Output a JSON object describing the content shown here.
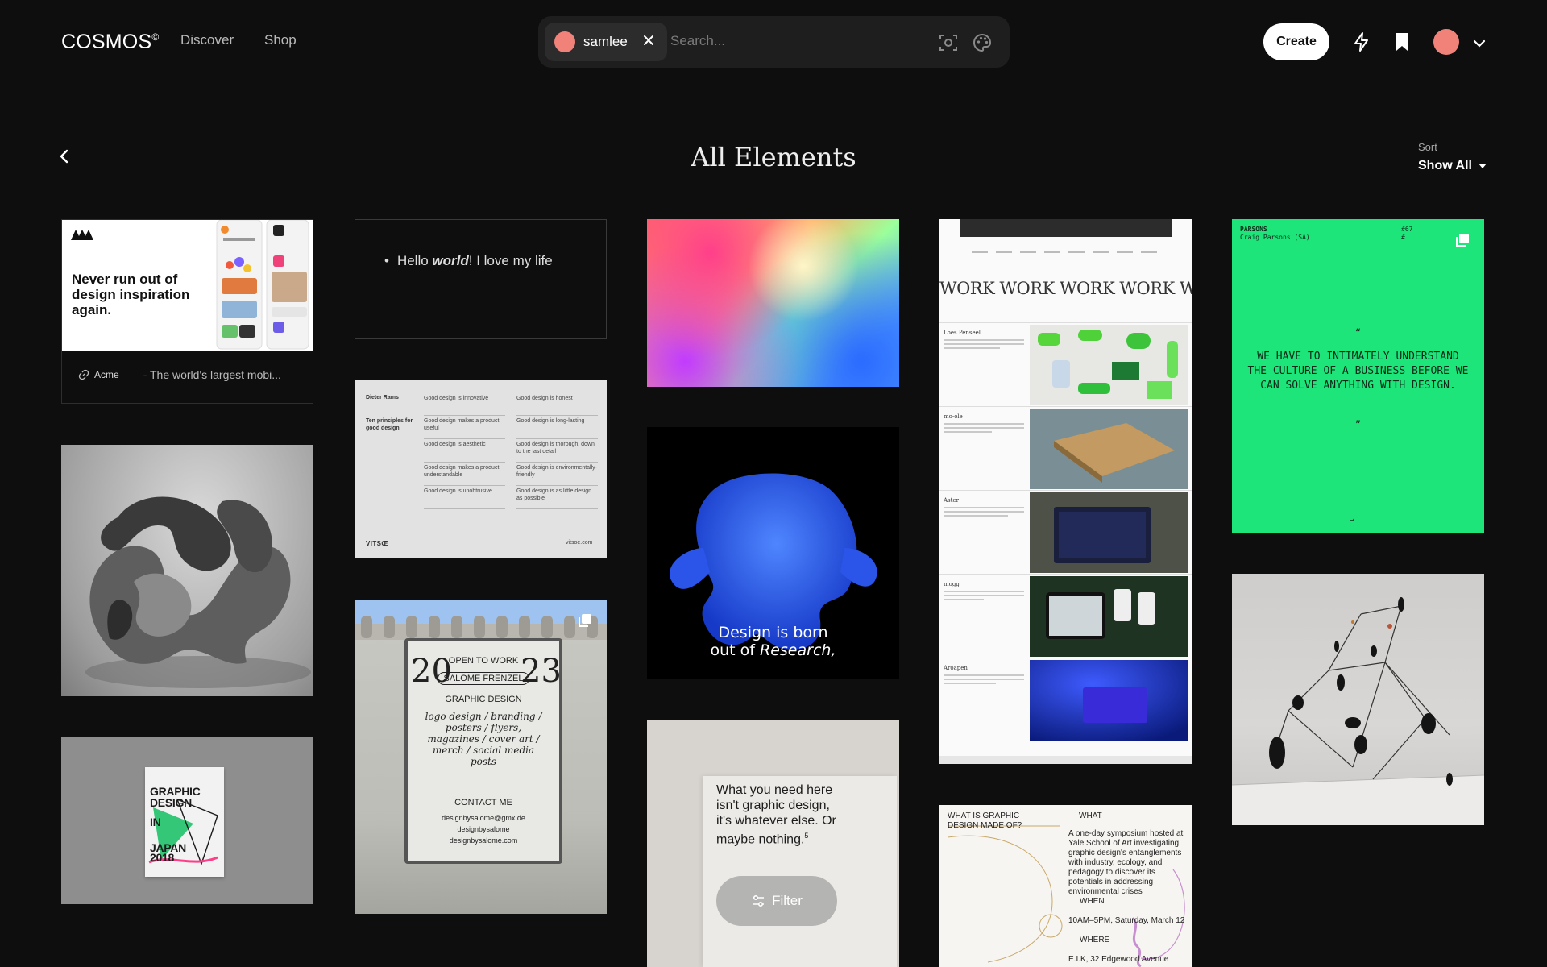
{
  "header": {
    "logo": "COSMOS",
    "logo_mark": "©",
    "nav": {
      "discover": "Discover",
      "shop": "Shop"
    },
    "search": {
      "chip_label": "samlee",
      "placeholder": "Search..."
    },
    "create_label": "Create",
    "icons": [
      "close-icon",
      "lens-icon",
      "palette-icon",
      "bolt-icon",
      "bookmark-icon",
      "chevron-down-icon"
    ]
  },
  "page": {
    "title": "All Elements",
    "sort_label": "Sort",
    "sort_value": "Show All"
  },
  "colors": {
    "background": "#0e0e0e",
    "accent_avatar": "#f0827a",
    "green_card": "#1de57a"
  },
  "cards": {
    "acme": {
      "headline": "Never run out of design inspiration again.",
      "link_name": "Acme",
      "link_desc": "- The world's largest mobi..."
    },
    "note": {
      "text_before": "Hello ",
      "emphasis": "world",
      "text_after": "! I love my life"
    },
    "work": {
      "repeat": "WORK WORK WORK WORK WORK W",
      "rows": [
        "Loes Penseel",
        "mo-ole",
        "Aster",
        "mogg",
        "Aroapen"
      ]
    },
    "green_quote": {
      "company": "PARSONS",
      "person": "Craig Parsons (SA)",
      "number": "#67",
      "hash": "#",
      "open_quote": "“",
      "quote": "WE HAVE TO INTIMATELY UNDERSTAND THE CULTURE OF A BUSINESS BEFORE WE CAN SOLVE ANYTHING WITH DESIGN.",
      "close_quote": "”",
      "arrow": "→"
    },
    "rams": {
      "name": "Dieter Rams",
      "subtitle": "Ten principles for good design",
      "principles": [
        "Good design is innovative",
        "Good design is honest",
        "Good design makes a product useful",
        "Good design is long-lasting",
        "Good design is aesthetic",
        "Good design is thorough, down to the last detail",
        "Good design makes a product understandable",
        "Good design is environmentally-friendly",
        "Good design is unobtrusive",
        "Good design is as little design as possible"
      ],
      "brand": "VITSŒ",
      "url": "vitsoe.com"
    },
    "video": {
      "caption_line1": "Design is born",
      "caption_line2_prefix": "out of ",
      "caption_line2_emph": "Research,"
    },
    "japan": {
      "line1": "GRAPHIC",
      "line2": "DESIGN",
      "line3": "IN",
      "line4": "JAPAN",
      "line5": "2018"
    },
    "open_to_work": {
      "num_left": "20",
      "num_right": "23",
      "line1": "OPEN TO WORK",
      "line2": "SALOME FRENZEL",
      "line3": "GRAPHIC DESIGN",
      "services": "logo design / branding / posters / flyers, magazines / cover art / merch / social media posts",
      "contact": "CONTACT ME",
      "email": "designbysalome@gmx.de",
      "handle": "designbysalome",
      "site": "designbysalome.com"
    },
    "need": {
      "text": "What you need here isn't graphic design, it's whatever else. Or maybe nothing.",
      "footnote": "5",
      "filter_label": "Filter"
    },
    "symposium": {
      "question": "WHAT IS GRAPHIC DESIGN MADE OF?",
      "what_label": "WHAT",
      "description": "A one-day symposium hosted at Yale School of Art investigating graphic design's entanglements with industry, ecology, and pedagogy to discover its potentials in addressing environmental crises",
      "when_label": "WHEN",
      "when_value": "10AM–5PM, Saturday, March 12",
      "where_label": "WHERE",
      "where_value": "E.I.K, 32 Edgewood Avenue"
    }
  }
}
